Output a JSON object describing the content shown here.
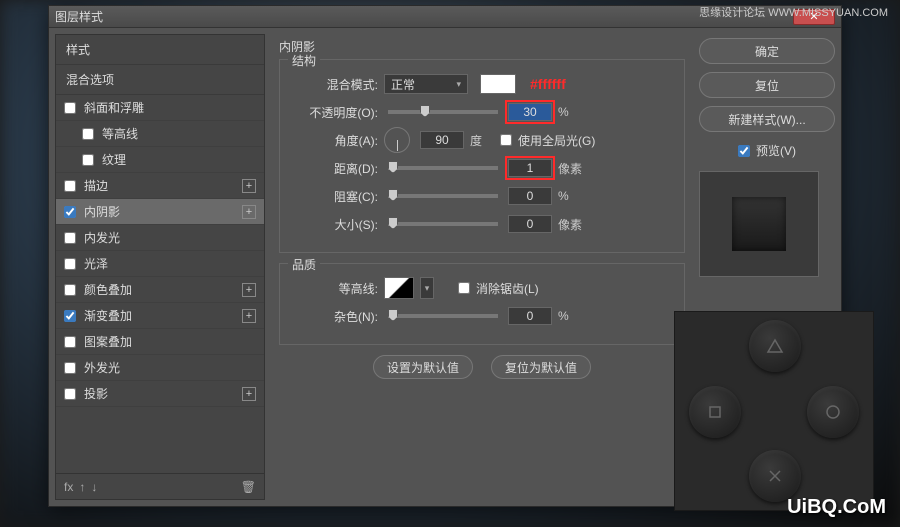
{
  "watermarks": {
    "top_right": "思缘设计论坛 WWW.MISSYUAN.COM",
    "bottom_right": "UiBQ.CoM"
  },
  "dialog": {
    "title": "图层样式"
  },
  "left": {
    "head1": "样式",
    "head2": "混合选项",
    "items": [
      {
        "label": "斜面和浮雕",
        "checked": false,
        "plus": false,
        "sub": false
      },
      {
        "label": "等高线",
        "checked": false,
        "plus": false,
        "sub": true
      },
      {
        "label": "纹理",
        "checked": false,
        "plus": false,
        "sub": true
      },
      {
        "label": "描边",
        "checked": false,
        "plus": true,
        "sub": false
      },
      {
        "label": "内阴影",
        "checked": true,
        "plus": true,
        "sub": false,
        "selected": true
      },
      {
        "label": "内发光",
        "checked": false,
        "plus": false,
        "sub": false
      },
      {
        "label": "光泽",
        "checked": false,
        "plus": false,
        "sub": false
      },
      {
        "label": "颜色叠加",
        "checked": false,
        "plus": true,
        "sub": false
      },
      {
        "label": "渐变叠加",
        "checked": true,
        "plus": true,
        "sub": false
      },
      {
        "label": "图案叠加",
        "checked": false,
        "plus": false,
        "sub": false
      },
      {
        "label": "外发光",
        "checked": false,
        "plus": false,
        "sub": false
      },
      {
        "label": "投影",
        "checked": false,
        "plus": true,
        "sub": false
      }
    ],
    "fx": "fx"
  },
  "center": {
    "title": "内阴影",
    "structure": {
      "legend": "结构",
      "blend_label": "混合模式:",
      "blend_value": "正常",
      "hex": "#ffffff",
      "opacity_label": "不透明度(O):",
      "opacity_value": "30",
      "opacity_unit": "%",
      "angle_label": "角度(A):",
      "angle_value": "90",
      "angle_unit": "度",
      "global_label": "使用全局光(G)",
      "global_checked": false,
      "distance_label": "距离(D):",
      "distance_value": "1",
      "distance_unit": "像素",
      "choke_label": "阻塞(C):",
      "choke_value": "0",
      "choke_unit": "%",
      "size_label": "大小(S):",
      "size_value": "0",
      "size_unit": "像素"
    },
    "quality": {
      "legend": "品质",
      "contour_label": "等高线:",
      "aa_label": "消除锯齿(L)",
      "noise_label": "杂色(N):",
      "noise_value": "0",
      "noise_unit": "%"
    },
    "buttons": {
      "make_default": "设置为默认值",
      "reset_default": "复位为默认值"
    }
  },
  "right": {
    "ok": "确定",
    "cancel": "复位",
    "new_style": "新建样式(W)...",
    "preview_label": "预览(V)",
    "preview_checked": true
  }
}
